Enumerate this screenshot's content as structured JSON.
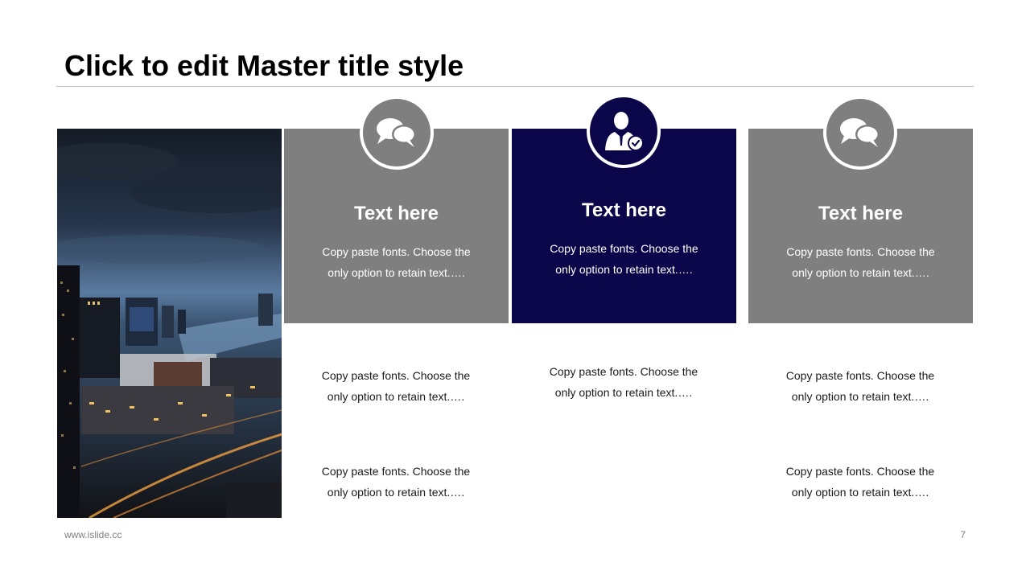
{
  "slide": {
    "title": "Click to edit Master title style",
    "footer_url": "www.islide.cc",
    "page_number": "7"
  },
  "photo": {
    "icon": "city-night-photo"
  },
  "columns": [
    {
      "icon": "speech-bubbles-icon",
      "heading": "Text here",
      "card_text_line1": "Copy paste fonts. Choose the",
      "card_text_line2": "only option to retain text.….",
      "body_1_line1": "Copy paste fonts. Choose the",
      "body_1_line2": "only option to retain text.….",
      "body_2_line1": "Copy paste fonts. Choose the",
      "body_2_line2": "only option to retain text.…."
    },
    {
      "icon": "businessman-check-icon",
      "heading": "Text here",
      "card_text_line1": "Copy paste fonts. Choose the",
      "card_text_line2": "only option to retain text.….",
      "body_1_line1": "Copy paste fonts. Choose the",
      "body_1_line2": "only option to retain text.…."
    },
    {
      "icon": "speech-bubbles-icon",
      "heading": "Text here",
      "card_text_line1": "Copy paste fonts. Choose the",
      "card_text_line2": "only option to retain text.….",
      "body_1_line1": "Copy paste fonts. Choose the",
      "body_1_line2": "only option to retain text.….",
      "body_2_line1": "Copy paste fonts. Choose the",
      "body_2_line2": "only option to retain text.…."
    }
  ],
  "colors": {
    "gray_card": "#7f7f7f",
    "navy_card": "#0b064a",
    "title": "#000000",
    "footer": "#7f7f7f"
  }
}
